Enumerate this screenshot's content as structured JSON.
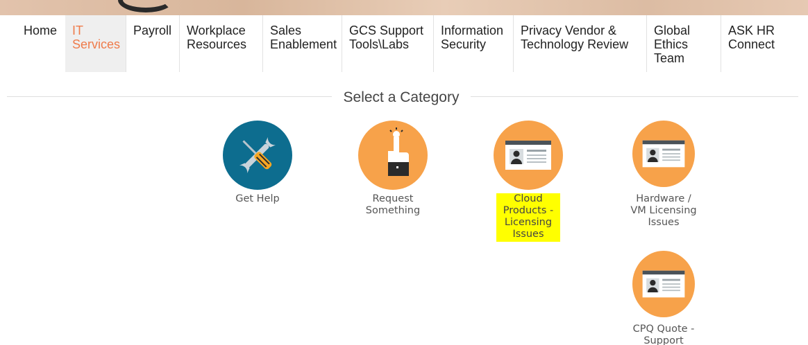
{
  "nav": {
    "items": [
      {
        "label": "Home"
      },
      {
        "label": "IT\nServices"
      },
      {
        "label": "Payroll"
      },
      {
        "label": "Workplace\nResources"
      },
      {
        "label": "Sales\nEnablement"
      },
      {
        "label": "GCS Support\nTools\\Labs"
      },
      {
        "label": "Information\nSecurity"
      },
      {
        "label": "Privacy Vendor &\nTechnology Review"
      },
      {
        "label": "Global\nEthics\nTeam"
      },
      {
        "label": "ASK HR\nConnect"
      }
    ],
    "active_index": 1
  },
  "section": {
    "title": "Select a Category"
  },
  "categories": [
    {
      "label": "Get Help",
      "icon": "wrench-screwdriver-icon",
      "color": "#0d6d8f"
    },
    {
      "label": "Request\nSomething",
      "icon": "hand-pointer-icon",
      "color": "#f7a24a"
    },
    {
      "label": "Cloud\nProducts -\nLicensing\nIssues",
      "icon": "id-card-icon",
      "color": "#f7a24a",
      "highlighted": true
    },
    {
      "label": "Hardware /\nVM Licensing\nIssues",
      "icon": "id-card-icon",
      "color": "#f7a24a"
    },
    {
      "label": "CPQ Quote -\nSupport",
      "icon": "id-card-icon",
      "color": "#f7a24a"
    }
  ],
  "colors": {
    "accent": "#ef7b4a",
    "highlight": "#ffff00",
    "teal": "#0d6d8f",
    "orange": "#f7a24a"
  }
}
